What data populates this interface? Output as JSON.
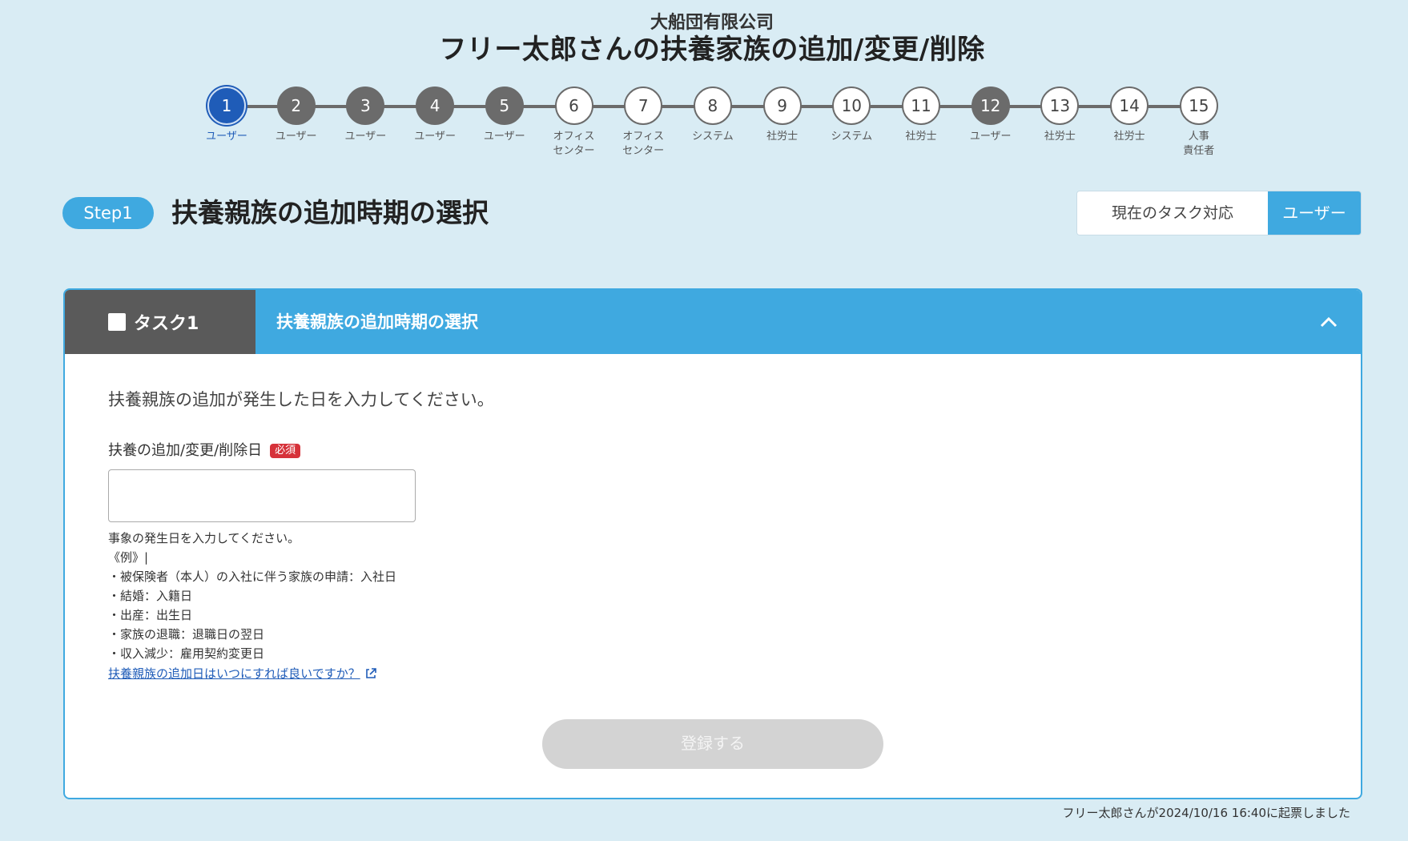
{
  "header": {
    "company": "大船団有限公司",
    "title": "フリー太郎さんの扶養家族の追加/変更/削除"
  },
  "stepper": {
    "steps": [
      {
        "number": "1",
        "label": "ユーザー",
        "state": "current"
      },
      {
        "number": "2",
        "label": "ユーザー",
        "state": "done"
      },
      {
        "number": "3",
        "label": "ユーザー",
        "state": "done"
      },
      {
        "number": "4",
        "label": "ユーザー",
        "state": "done"
      },
      {
        "number": "5",
        "label": "ユーザー",
        "state": "done"
      },
      {
        "number": "6",
        "label": "オフィス\nセンター",
        "state": "todo"
      },
      {
        "number": "7",
        "label": "オフィス\nセンター",
        "state": "todo"
      },
      {
        "number": "8",
        "label": "システム",
        "state": "todo"
      },
      {
        "number": "9",
        "label": "社労士",
        "state": "todo"
      },
      {
        "number": "10",
        "label": "システム",
        "state": "todo"
      },
      {
        "number": "11",
        "label": "社労士",
        "state": "todo"
      },
      {
        "number": "12",
        "label": "ユーザー",
        "state": "done"
      },
      {
        "number": "13",
        "label": "社労士",
        "state": "todo"
      },
      {
        "number": "14",
        "label": "社労士",
        "state": "todo"
      },
      {
        "number": "15",
        "label": "人事\n責任者",
        "state": "todo"
      }
    ]
  },
  "step_header": {
    "pill": "Step1",
    "title": "扶養親族の追加時期の選択",
    "task_owner_label": "現在のタスク対応",
    "task_owner_value": "ユーザー"
  },
  "card": {
    "tab_label": "タスク1",
    "title": "扶養親族の追加時期の選択",
    "instruction": "扶養親族の追加が発生した日を入力してください。",
    "field_label": "扶養の追加/変更/削除日",
    "required_label": "必須",
    "date_value": "",
    "help_lines": [
      "事象の発生日を入力してください。",
      "《例》|",
      "・被保険者（本人）の入社に伴う家族の申請：入社日",
      "・結婚：入籍日",
      "・出産：出生日",
      "・家族の退職：退職日の翌日",
      "・収入減少：雇用契約変更日"
    ],
    "help_link": "扶養親族の追加日はいつにすれば良いですか？",
    "submit_label": "登録する"
  },
  "footer": {
    "note": "フリー太郎さんが2024/10/16 16:40に起票しました"
  },
  "colors": {
    "accent": "#3fa9e0",
    "current_step": "#1f5cb8",
    "done_step": "#6b6b6b",
    "required": "#d6323a",
    "background": "#d9ecf4"
  }
}
